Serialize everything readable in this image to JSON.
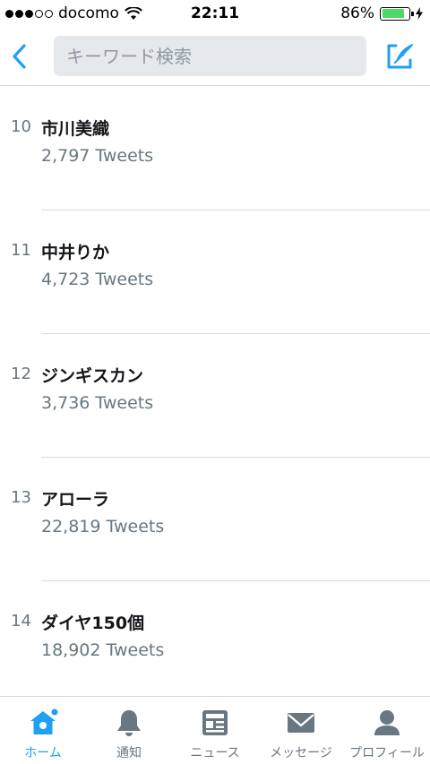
{
  "status_bar": {
    "carrier": "docomo",
    "time": "22:11",
    "battery_percent": "86%",
    "battery_level": 0.86,
    "signal_bars_filled": 3,
    "signal_bars_total": 5
  },
  "nav": {
    "search_placeholder": "キーワード検索",
    "accent_color": "#1da1f2"
  },
  "trends": [
    {
      "rank": "10",
      "name": "市川美織",
      "tweets": "2,797 Tweets"
    },
    {
      "rank": "11",
      "name": "中井りか",
      "tweets": "4,723 Tweets"
    },
    {
      "rank": "12",
      "name": "ジンギスカン",
      "tweets": "3,736 Tweets"
    },
    {
      "rank": "13",
      "name": "アローラ",
      "tweets": "22,819 Tweets"
    },
    {
      "rank": "14",
      "name": "ダイヤ150個",
      "tweets": "18,902 Tweets"
    }
  ],
  "tabs": [
    {
      "label": "ホーム",
      "icon": "home-icon",
      "active": true
    },
    {
      "label": "通知",
      "icon": "bell-icon",
      "active": false
    },
    {
      "label": "ニュース",
      "icon": "news-icon",
      "active": false
    },
    {
      "label": "メッセージ",
      "icon": "envelope-icon",
      "active": false
    },
    {
      "label": "プロフィール",
      "icon": "person-icon",
      "active": false
    }
  ]
}
